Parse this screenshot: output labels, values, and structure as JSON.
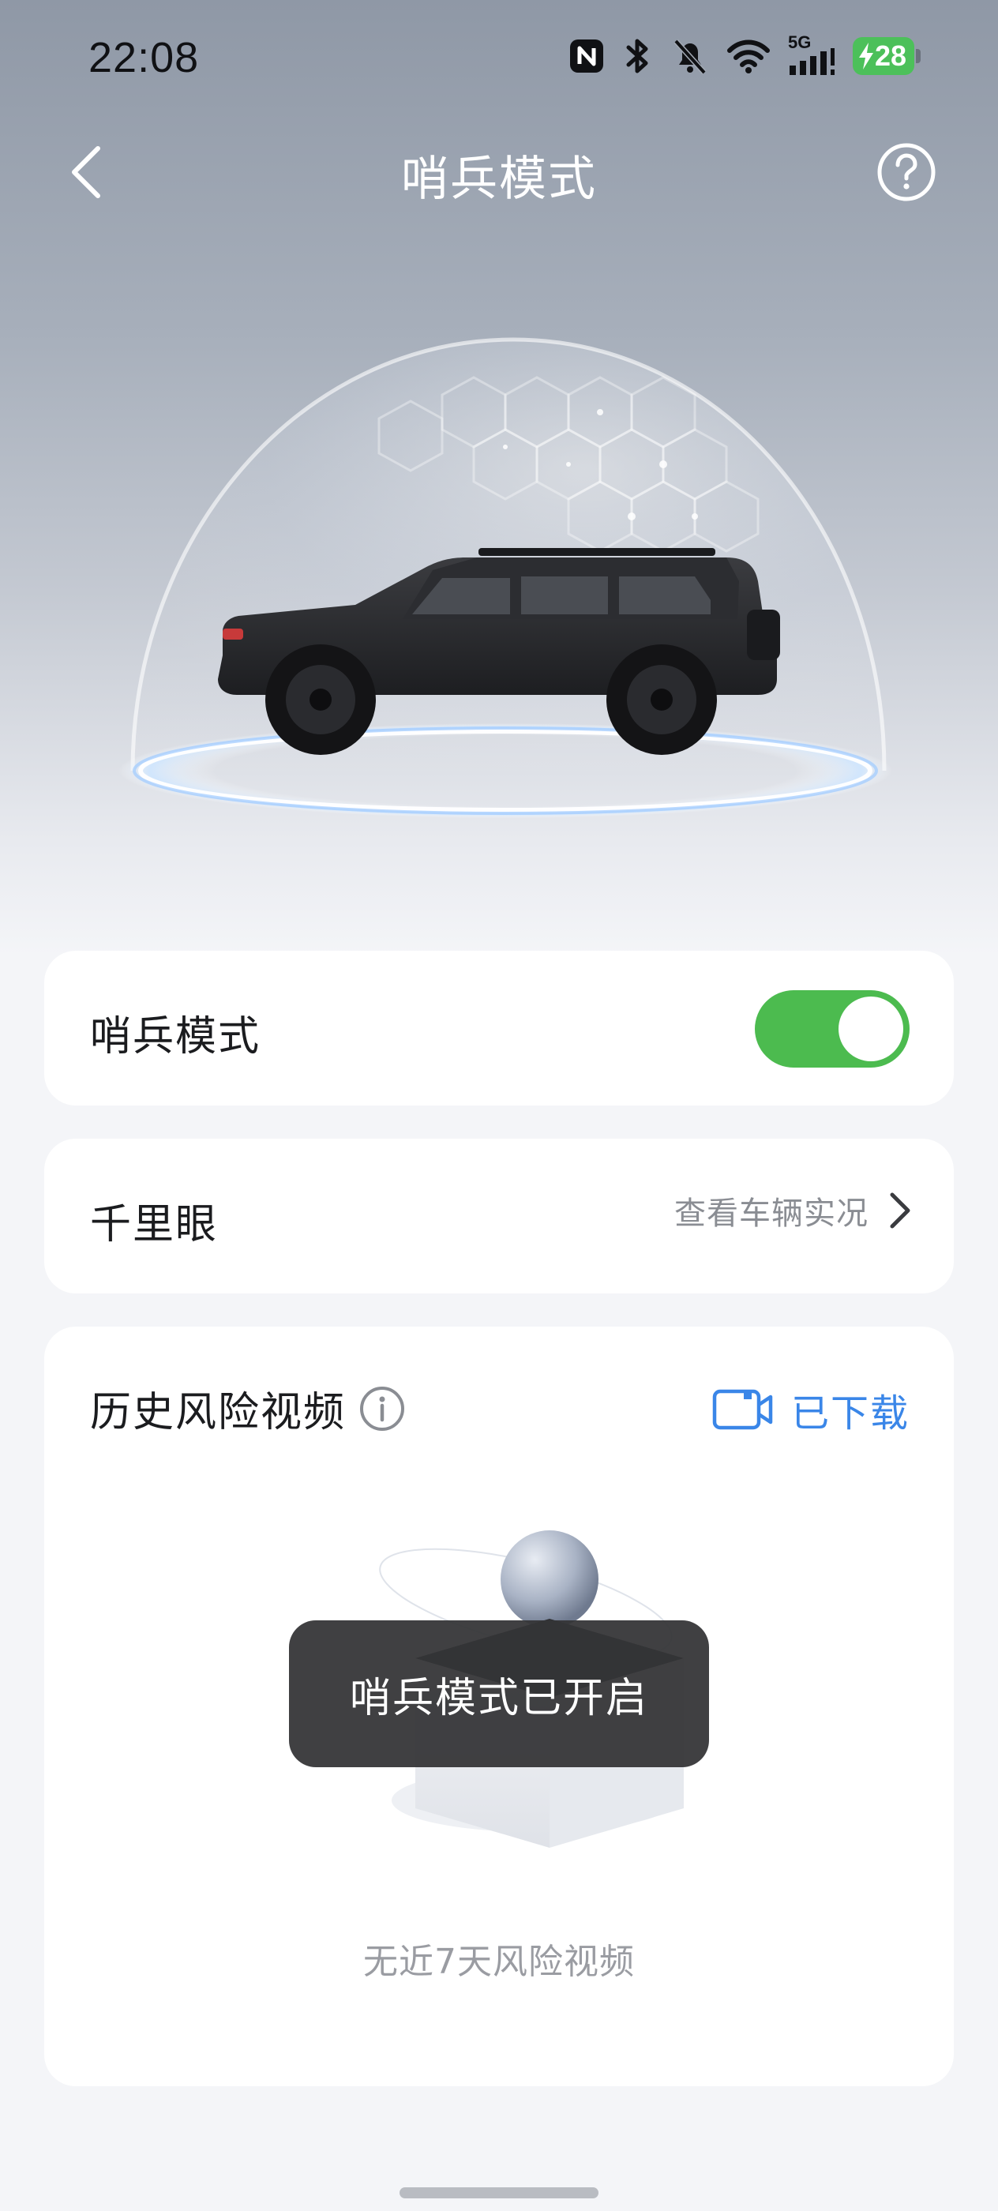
{
  "status_bar": {
    "time": "22:08",
    "network_label": "5G",
    "battery_level": "28",
    "icons": [
      "nfc-icon",
      "bluetooth-icon",
      "mute-bell-icon",
      "wifi-icon",
      "signal-icon",
      "battery-icon"
    ]
  },
  "header": {
    "title": "哨兵模式",
    "back_icon": "chevron-left-icon",
    "help_icon": "question-circle-icon"
  },
  "sentry_card": {
    "label": "哨兵模式",
    "toggle_on": true,
    "toggle_color": "#4cbb4f"
  },
  "eye_card": {
    "label": "千里眼",
    "link_text": "查看车辆实况",
    "link_icon": "chevron-right-icon"
  },
  "history_card": {
    "title": "历史风险视频",
    "info_icon": "info-circle-icon",
    "downloaded_label": "已下载",
    "downloaded_icon": "video-camera-icon",
    "empty_text": "无近7天风险视频"
  },
  "toast": {
    "text": "哨兵模式已开启"
  },
  "colors": {
    "accent_blue": "#3a86e8",
    "toggle_green": "#4cbb4f",
    "battery_green": "#4cc05a"
  }
}
